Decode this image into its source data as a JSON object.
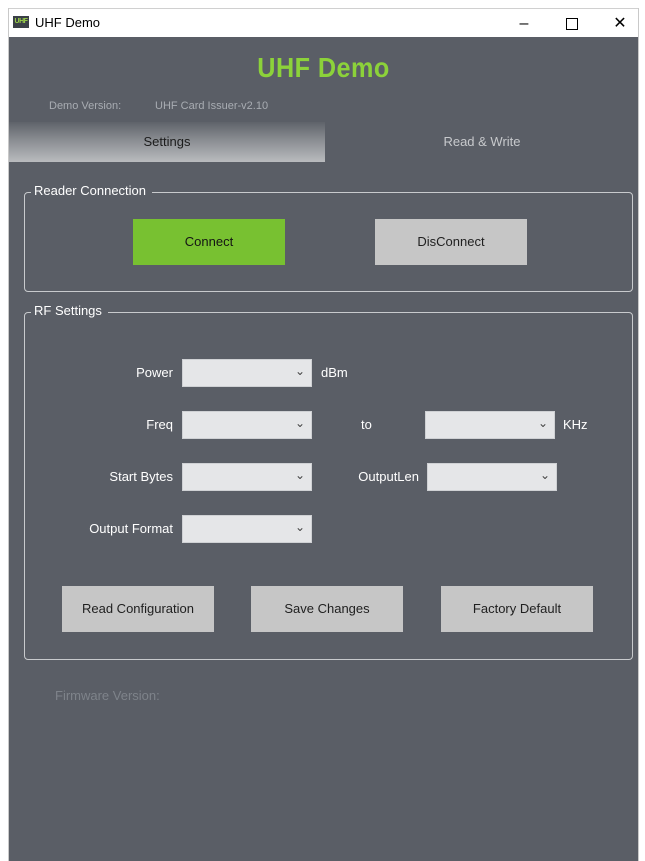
{
  "window": {
    "title": "UHF Demo",
    "icon_text": "UHF",
    "controls": {
      "minimize": "–",
      "close": "✕"
    }
  },
  "header": {
    "app_title": "UHF Demo",
    "version_label": "Demo Version:",
    "version_value": "UHF Card Issuer-v2.10"
  },
  "tabs": [
    {
      "label": "Settings",
      "active": true
    },
    {
      "label": "Read & Write",
      "active": false
    }
  ],
  "reader_connection": {
    "title": "Reader Connection",
    "connect_label": "Connect",
    "disconnect_label": "DisConnect"
  },
  "rf_settings": {
    "title": "RF Settings",
    "power_label": "Power",
    "power_value": "",
    "power_unit": "dBm",
    "freq_label": "Freq",
    "freq_from_value": "",
    "freq_to_label": "to",
    "freq_to_value": "",
    "freq_unit": "KHz",
    "start_bytes_label": "Start Bytes",
    "start_bytes_value": "",
    "output_len_label": "OutputLen",
    "output_len_value": "",
    "output_format_label": "Output Format",
    "output_format_value": "",
    "read_config_label": "Read Configuration",
    "save_changes_label": "Save Changes",
    "factory_default_label": "Factory Default"
  },
  "footer": {
    "firmware_label": "Firmware Version:"
  },
  "colors": {
    "background": "#5a5e66",
    "accent_green": "#8cd23a",
    "connect_green": "#78c131",
    "button_gray": "#c6c6c6"
  }
}
